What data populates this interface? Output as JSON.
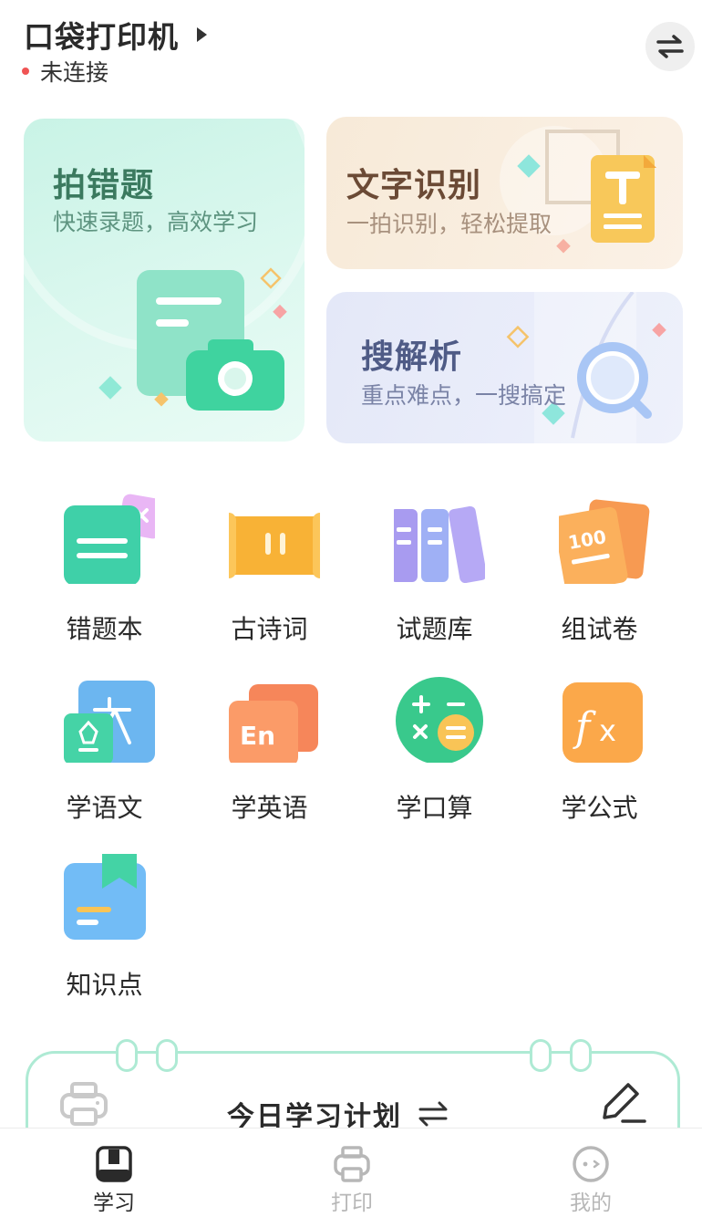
{
  "header": {
    "title": "口袋打印机",
    "status": "未连接",
    "status_color": "#f05454"
  },
  "cards": {
    "wrong_questions": {
      "title": "拍错题",
      "subtitle": "快速录题，高效学习"
    },
    "text_recognition": {
      "title": "文字识别",
      "subtitle": "一拍识别，轻松提取"
    },
    "search_analysis": {
      "title": "搜解析",
      "subtitle": "重点难点，一搜搞定"
    }
  },
  "grid": {
    "items": [
      {
        "label": "错题本",
        "icon": "wrong-notebook-icon"
      },
      {
        "label": "古诗词",
        "icon": "scroll-icon"
      },
      {
        "label": "试题库",
        "icon": "books-icon"
      },
      {
        "label": "组试卷",
        "icon": "test-paper-icon"
      },
      {
        "label": "学语文",
        "icon": "chinese-icon"
      },
      {
        "label": "学英语",
        "icon": "english-icon"
      },
      {
        "label": "学口算",
        "icon": "calculator-icon"
      },
      {
        "label": "学公式",
        "icon": "formula-icon"
      },
      {
        "label": "知识点",
        "icon": "bookmark-icon"
      }
    ]
  },
  "plan": {
    "title": "今日学习计划",
    "accent": "#aeead4"
  },
  "nav": {
    "study": "学习",
    "print": "打印",
    "mine": "我的",
    "active": "study"
  }
}
